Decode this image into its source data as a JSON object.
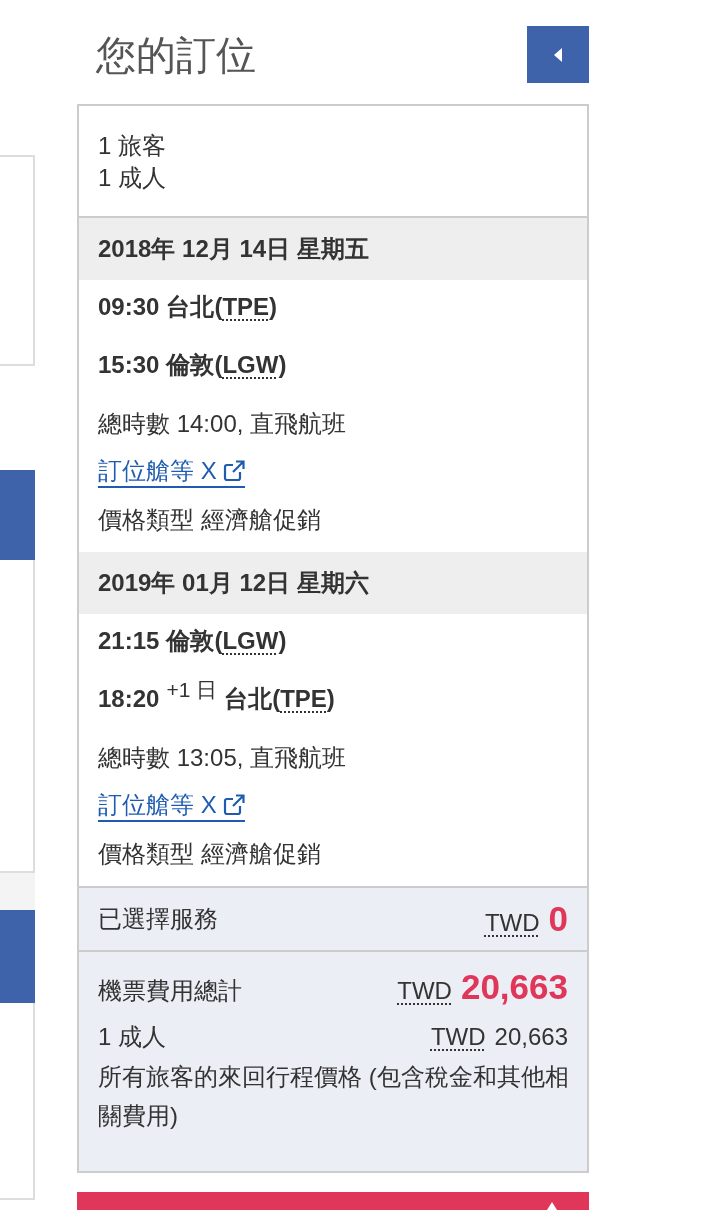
{
  "header": {
    "title": "您的訂位"
  },
  "passengers": [
    "1 旅客",
    "1 成人"
  ],
  "segments": [
    {
      "date": "2018年 12月 14日 星期五",
      "departure": {
        "time": "09:30",
        "place": "台北(",
        "code": "TPE",
        "place_end": ")"
      },
      "arrival": {
        "time": "15:30",
        "place": "倫敦(",
        "code": "LGW",
        "place_end": ")"
      },
      "duration": "總時數 14:00, 直飛航班",
      "fare_link": "訂位艙等 X",
      "fare_type": "價格類型 經濟艙促銷"
    },
    {
      "date": "2019年 01月 12日 星期六",
      "departure": {
        "time": "21:15",
        "place": "倫敦(",
        "code": "LGW",
        "place_end": ")"
      },
      "arrival": {
        "time": "18:20",
        "day_offset": "+1 日",
        "place": "台北(",
        "code": "TPE",
        "place_end": ")"
      },
      "duration": "總時數 13:05, 直飛航班",
      "fare_link": "訂位艙等 X",
      "fare_type": "價格類型 經濟艙促銷"
    }
  ],
  "services": {
    "label": "已選擇服務",
    "currency": "TWD",
    "amount": "0"
  },
  "total": {
    "label": "機票費用總計",
    "currency": "TWD",
    "amount": "20,663"
  },
  "passenger_price": {
    "label": "1 成人",
    "currency": "TWD",
    "amount": "20,663"
  },
  "note": "所有旅客的來回行程價格 (包含稅金和其他相關費用)"
}
